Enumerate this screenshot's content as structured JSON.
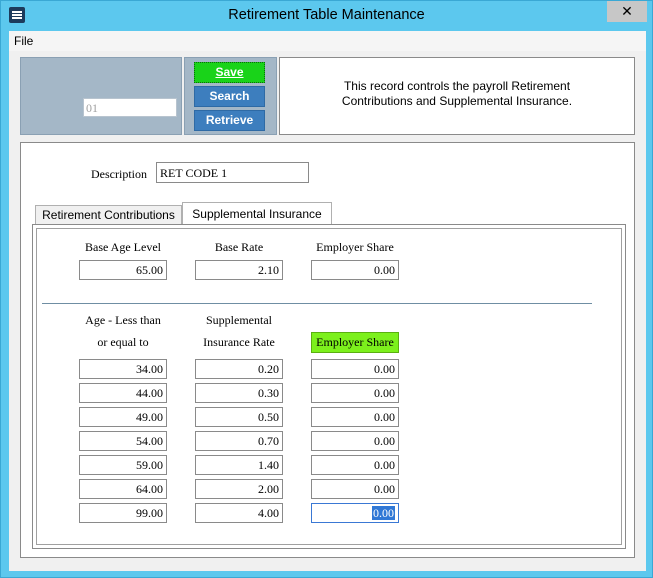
{
  "window": {
    "title": "Retirement Table Maintenance",
    "close_glyph": "✕"
  },
  "menu": {
    "file": "File"
  },
  "key": {
    "code": "01"
  },
  "buttons": {
    "save": "Save",
    "search": "Search",
    "retrieve": "Retrieve"
  },
  "info": {
    "text": "This record controls the payroll Retirement Contributions and Supplemental Insurance."
  },
  "description": {
    "label": "Description",
    "value": "RET CODE 1"
  },
  "tabs": [
    {
      "label": "Retirement Contributions",
      "active": false
    },
    {
      "label": "Supplemental Insurance",
      "active": true
    }
  ],
  "base": {
    "age_label": "Base Age Level",
    "rate_label": "Base Rate",
    "share_label": "Employer Share",
    "age": "65.00",
    "rate": "2.10",
    "share": "0.00"
  },
  "table": {
    "col1_line1": "Age - Less than",
    "col1_line2": "or equal to",
    "col2_line1": "Supplemental",
    "col2_line2": "Insurance Rate",
    "col3": "Employer Share",
    "rows": [
      {
        "age": "34.00",
        "rate": "0.20",
        "share": "0.00"
      },
      {
        "age": "44.00",
        "rate": "0.30",
        "share": "0.00"
      },
      {
        "age": "49.00",
        "rate": "0.50",
        "share": "0.00"
      },
      {
        "age": "54.00",
        "rate": "0.70",
        "share": "0.00"
      },
      {
        "age": "59.00",
        "rate": "1.40",
        "share": "0.00"
      },
      {
        "age": "64.00",
        "rate": "2.00",
        "share": "0.00"
      },
      {
        "age": "99.00",
        "rate": "4.00",
        "share": "0.00"
      }
    ]
  },
  "colors": {
    "titlebar": "#5cc8ee",
    "save_button": "#19d319",
    "button": "#3d7ebe",
    "highlight_header": "#7cf01c"
  }
}
